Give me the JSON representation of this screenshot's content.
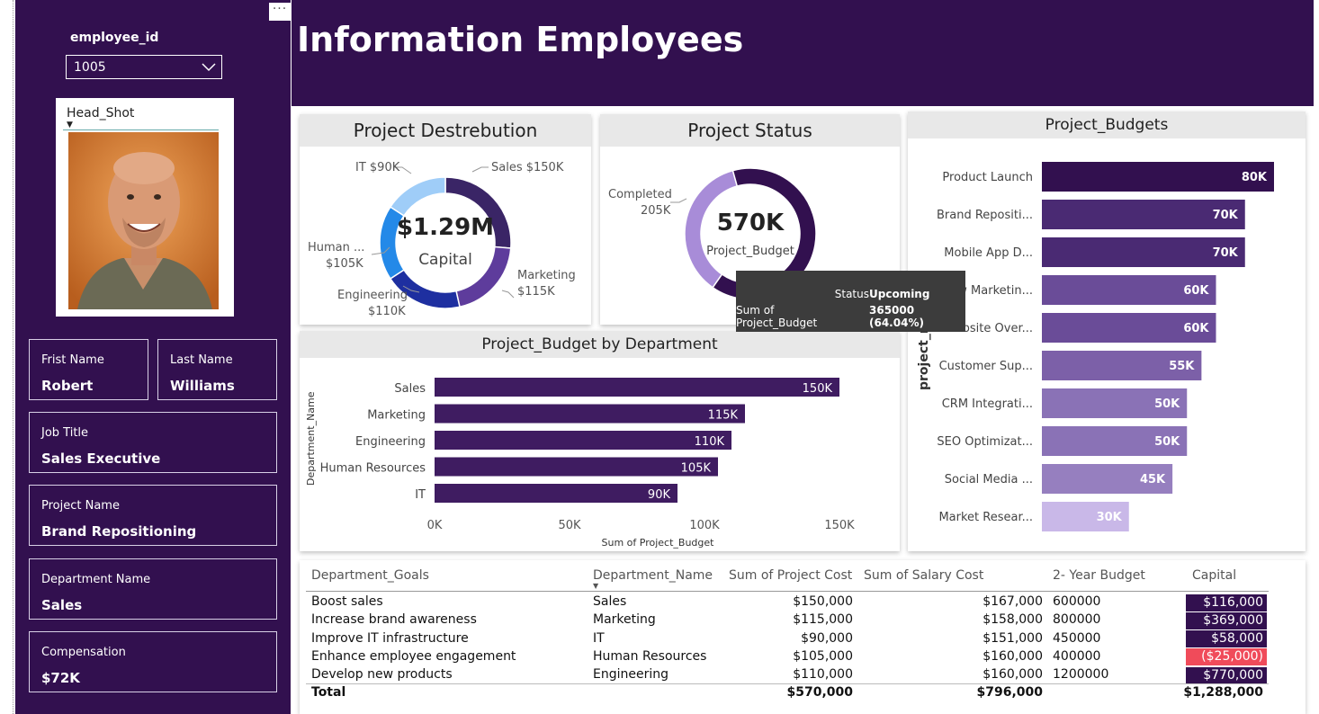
{
  "sidebar": {
    "slicer_label": "employee_id",
    "slicer_value": "1005",
    "headshot_title": "Head_Shot",
    "first_name": {
      "label": "Frist Name",
      "value": "Robert"
    },
    "last_name": {
      "label": "Last Name",
      "value": "Williams"
    },
    "job_title": {
      "label": "Job Title",
      "value": "Sales Executive"
    },
    "project_name": {
      "label": "Project Name",
      "value": "Brand Repositioning"
    },
    "department": {
      "label": "Department Name",
      "value": "Sales"
    },
    "compensation": {
      "label": "Compensation",
      "value": "$72K"
    }
  },
  "header": {
    "title": "Information Employees",
    "more": "···"
  },
  "colors": {
    "brand": "#32104f",
    "negative": "#f04b5a"
  },
  "donut1": {
    "title": "Project Destrebution",
    "center_value": "$1.29M",
    "center_label": "Capital",
    "labels": {
      "sales": "Sales $150K",
      "marketing1": "Marketing",
      "marketing2": "$115K",
      "engineering1": "Engineering",
      "engineering2": "$110K",
      "hr1": "Human ...",
      "hr2": "$105K",
      "it": "IT $90K"
    }
  },
  "donut2": {
    "title": "Project Status",
    "center_value": "570K",
    "center_label": "Project_Budget",
    "labels": {
      "completed1": "Completed",
      "completed2": "205K"
    }
  },
  "tooltip": {
    "k1": "Status",
    "v1": "Upcoming",
    "k2": "Sum of Project_Budget",
    "v2": "365000 (64.04%)"
  },
  "chart_data": [
    {
      "type": "pie",
      "title": "Project Destrebution",
      "categories": [
        "Sales",
        "Marketing",
        "Engineering",
        "Human Resources",
        "IT"
      ],
      "values": [
        150,
        115,
        110,
        105,
        90
      ],
      "colors": [
        "#3a2566",
        "#5e3c9c",
        "#1e2fa0",
        "#2489e8",
        "#9fcdf8"
      ]
    },
    {
      "type": "pie",
      "title": "Project Status",
      "categories": [
        "Completed",
        "Upcoming"
      ],
      "values": [
        205,
        365
      ],
      "colors": [
        "#a88cd8",
        "#32104f"
      ]
    },
    {
      "type": "bar",
      "title": "Project_Budget by Department",
      "xlabel": "Sum of Project_Budget",
      "ylabel": "Department_Name",
      "categories": [
        "Sales",
        "Marketing",
        "Engineering",
        "Human Resources",
        "IT"
      ],
      "values": [
        150,
        115,
        110,
        105,
        90
      ],
      "data_labels": [
        "150K",
        "115K",
        "110K",
        "105K",
        "90K"
      ],
      "xticks": [
        "0K",
        "50K",
        "100K",
        "150K"
      ],
      "xlim": [
        0,
        150
      ]
    },
    {
      "type": "bar",
      "title": "Project_Budgets",
      "ylabel": "project_na...",
      "categories": [
        "Product Launch",
        "Brand Repositi...",
        "Mobile App D...",
        "New Marketin...",
        "Website Over...",
        "Customer Sup...",
        "CRM Integrati...",
        "SEO Optimizat...",
        "Social Media ...",
        "Market Resear..."
      ],
      "values": [
        80,
        70,
        70,
        60,
        60,
        55,
        50,
        50,
        45,
        30
      ],
      "data_labels": [
        "80K",
        "70K",
        "70K",
        "60K",
        "60K",
        "55K",
        "50K",
        "50K",
        "45K",
        "30K"
      ],
      "colors": [
        "#32104f",
        "#4a2a73",
        "#4a2a73",
        "#6a4c98",
        "#6a4c98",
        "#7c60a8",
        "#8a72b6",
        "#8a72b6",
        "#967fbf",
        "#c9b8e8"
      ]
    }
  ],
  "table": {
    "headers": [
      "Department_Goals",
      "Department_Name",
      "Sum of Project Cost",
      "Sum of Salary Cost",
      "2- Year Budget",
      "Capital"
    ],
    "rows": [
      [
        "Boost sales",
        "Sales",
        "$150,000",
        "$167,000",
        "600000",
        "$116,000"
      ],
      [
        "Increase brand awareness",
        "Marketing",
        "$115,000",
        "$158,000",
        "800000",
        "$369,000"
      ],
      [
        "Improve IT infrastructure",
        "IT",
        "$90,000",
        "$151,000",
        "450000",
        "$58,000"
      ],
      [
        "Enhance employee engagement",
        "Human Resources",
        "$105,000",
        "$160,000",
        "400000",
        "($25,000)"
      ],
      [
        "Develop new products",
        "Engineering",
        "$110,000",
        "$160,000",
        "1200000",
        "$770,000"
      ]
    ],
    "total": [
      "Total",
      "$570,000",
      "$796,000",
      "$1,288,000"
    ]
  }
}
